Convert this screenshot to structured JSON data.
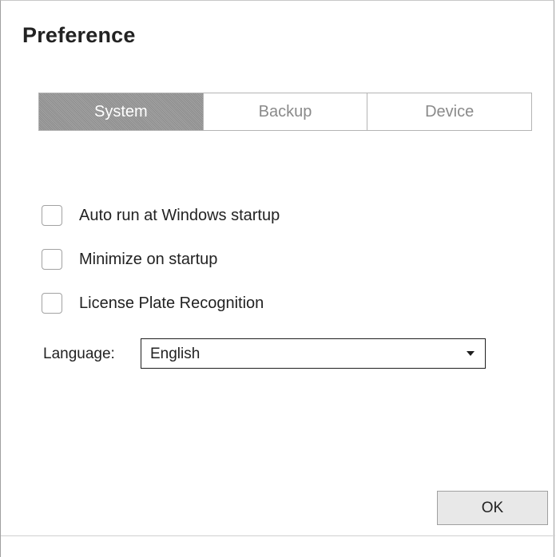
{
  "dialog": {
    "title": "Preference"
  },
  "tabs": [
    {
      "label": "System",
      "active": true
    },
    {
      "label": "Backup",
      "active": false
    },
    {
      "label": "Device",
      "active": false
    }
  ],
  "options": [
    {
      "label": "Auto run at Windows startup",
      "checked": false
    },
    {
      "label": "Minimize on startup",
      "checked": false
    },
    {
      "label": "License Plate Recognition",
      "checked": false
    }
  ],
  "language": {
    "label": "Language:",
    "value": "English"
  },
  "footer": {
    "ok_label": "OK"
  },
  "colors": {
    "active_tab_bg": "#999999",
    "inactive_tab_text": "#8a8a8a",
    "ok_button_bg": "#e8e8e8"
  }
}
